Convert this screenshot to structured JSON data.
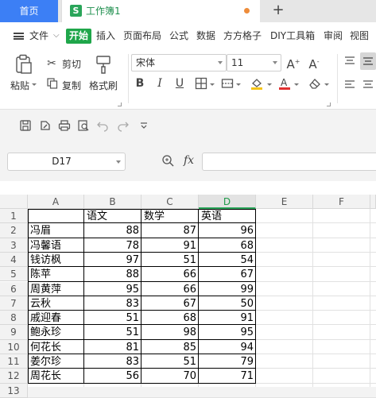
{
  "tabs": {
    "home": "首页",
    "doc_icon": "S",
    "doc": "工作簿1",
    "new": "+"
  },
  "menu": {
    "file": "文件",
    "start": "开始",
    "items": [
      "插入",
      "页面布局",
      "公式",
      "数据",
      "方方格子",
      "DIY工具箱",
      "审阅",
      "视图"
    ]
  },
  "ribbon": {
    "paste": "粘贴",
    "cut": "剪切",
    "copy": "复制",
    "format_painter": "格式刷",
    "font_name": "宋体",
    "font_size": "11",
    "bold": "B",
    "italic": "I",
    "underline": "U",
    "font_color_accent": "#e03030",
    "fill_color_accent": "#f5c518"
  },
  "namebox": {
    "value": "D17"
  },
  "formula": {
    "fx": "fx",
    "value": ""
  },
  "sheet": {
    "columns": [
      "A",
      "B",
      "C",
      "D",
      "E",
      "F"
    ],
    "active_column": "D",
    "rows": [
      "1",
      "2",
      "3",
      "4",
      "5",
      "6",
      "7",
      "8",
      "9",
      "10",
      "11",
      "12",
      "13"
    ],
    "header": [
      "",
      "语文",
      "数学",
      "英语"
    ],
    "data": [
      [
        "冯眉",
        88,
        87,
        96
      ],
      [
        "冯馨语",
        78,
        91,
        68
      ],
      [
        "钱访枫",
        97,
        51,
        54
      ],
      [
        "陈苹",
        88,
        66,
        67
      ],
      [
        "周黄萍",
        95,
        66,
        99
      ],
      [
        "云秋",
        83,
        67,
        50
      ],
      [
        "戚迎春",
        51,
        68,
        91
      ],
      [
        "鲍永珍",
        51,
        98,
        95
      ],
      [
        "何花长",
        81,
        85,
        94
      ],
      [
        "姜尔珍",
        83,
        51,
        79
      ],
      [
        "周花长",
        56,
        70,
        71
      ]
    ]
  }
}
